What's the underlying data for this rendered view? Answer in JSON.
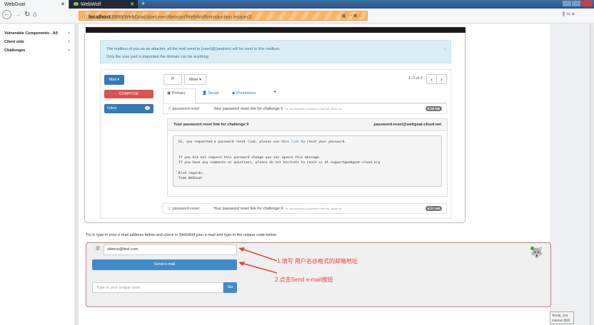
{
  "browser": {
    "tabs": [
      {
        "label": "WebGoat"
      },
      {
        "label": "WebWolf"
      }
    ],
    "new_tab": "+",
    "url_host": "localhost",
    "url_rest": ":8888/WebGoat/start.mvc#lesson/WebWolfIntroduction.lesson/2"
  },
  "sidebar": {
    "items": [
      {
        "label": "Vulnerable Components - A9"
      },
      {
        "label": "Client side"
      },
      {
        "label": "Challenges"
      }
    ],
    "chevron": ">"
  },
  "alert": {
    "line1": "The mailbox of you as an attacker, all the mail send to {user}@{random} will be send to this mailbox.",
    "line2": "Only the user part is important the domain can be anything",
    "close": "×"
  },
  "mail": {
    "mail_btn": "Mail ▾",
    "compose": "COMPOSE",
    "inbox": "Inbox",
    "inbox_count": "2",
    "refresh": "⟳",
    "more": "More ▾",
    "pager": "1–2 of 2",
    "prev": "‹",
    "next": "›",
    "tabs": [
      {
        "label": "Primary"
      },
      {
        "label": "Social"
      },
      {
        "label": "Promotions"
      },
      {
        "label": "+"
      }
    ],
    "rows": [
      {
        "sender": "password-reset",
        "subject": "Your password reset link for challenge 9",
        "snippet": "- Hi, you requested a password reset link, please us",
        "time": "6:28 AM"
      },
      {
        "sender": "password-reset",
        "subject": "Your password reset link for challenge 9",
        "snippet": "- Hi, you requested a password reset link, please us",
        "time": "6:27 AM"
      }
    ],
    "preview": {
      "subject": "Your password reset link for challenge 9",
      "from": "password-reset@webgoat-cloud.net",
      "body_pre": "Hi, you requested a password reset link, please use this ",
      "link": "link",
      "body_post": " to reset your password.",
      "body_rest": "\n\n\nIf you did not request this password change you can ignore this message.\nIf you have any comments or questions, please do not hesitate to reach us at support@webgoat-cloud.org\n\nKind regards,\nTeam WebGoat"
    }
  },
  "form": {
    "instructions": "Try it, type in your e-mail address below and check in WebWolf your e-mail and type in the unique code below",
    "at": "@",
    "email_value": "silence@test.com",
    "send": "Send e-mail",
    "code_placeholder": "Type in your unique code",
    "go": "Go"
  },
  "annotations": {
    "a1": "1.填写 用户名@格式的邮箱地址",
    "a2": "2.点击Send e-mail按钮"
  },
  "tooltip": {
    "line1": "Tenda_123",
    "line2": "Internet 访问"
  }
}
